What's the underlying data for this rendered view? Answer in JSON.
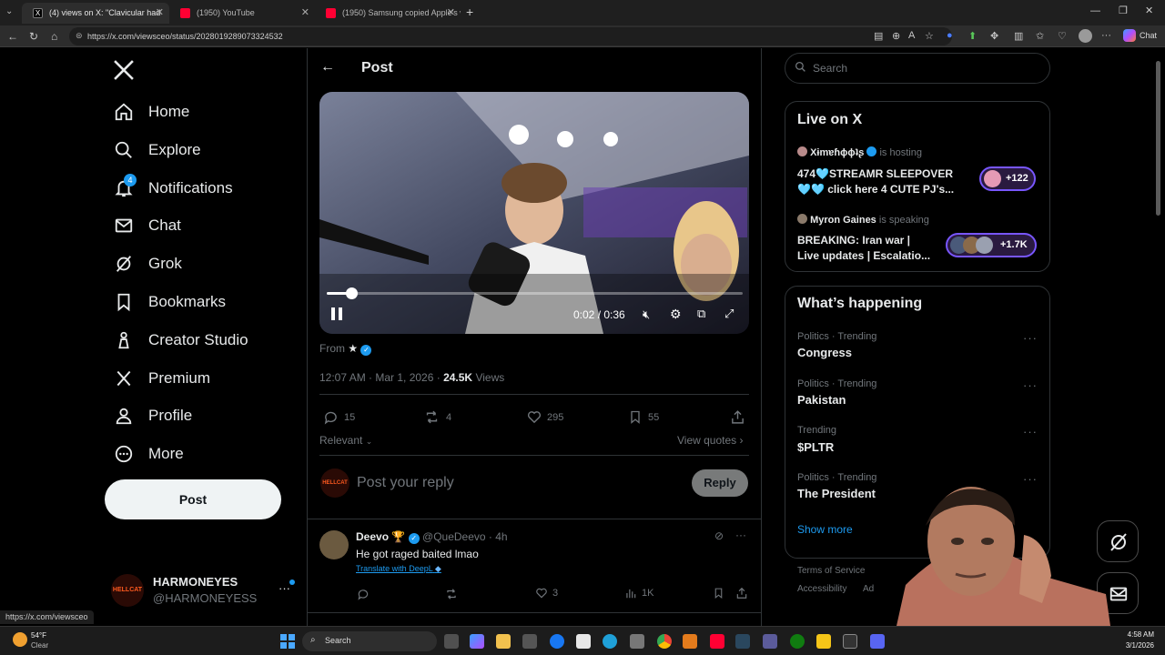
{
  "browser": {
    "tabs": [
      {
        "title": "(4) views on X: \"Clavicular had",
        "active": true
      },
      {
        "title": "(1950) YouTube",
        "active": false
      },
      {
        "title": "(1950) Samsung copied Apple's w",
        "active": false
      }
    ],
    "url": "https://x.com/viewsceo/status/2028019289073324532",
    "copilot_label": "Chat",
    "status_url": "https://x.com/viewsceo"
  },
  "nav": {
    "items": [
      {
        "label": "Home",
        "icon": "home-icon"
      },
      {
        "label": "Explore",
        "icon": "search-icon"
      },
      {
        "label": "Notifications",
        "icon": "bell-icon",
        "badge": "4"
      },
      {
        "label": "Chat",
        "icon": "mail-icon"
      },
      {
        "label": "Grok",
        "icon": "grok-icon"
      },
      {
        "label": "Bookmarks",
        "icon": "bookmark-icon"
      },
      {
        "label": "Creator Studio",
        "icon": "creator-studio-icon"
      },
      {
        "label": "Premium",
        "icon": "x-logo-icon"
      },
      {
        "label": "Profile",
        "icon": "person-icon"
      },
      {
        "label": "More",
        "icon": "more-circle-icon"
      }
    ],
    "post_button": "Post",
    "account": {
      "name": "HARMONEYES",
      "handle": "@HARMONEYESS",
      "avatar_text": "HELLCAT"
    }
  },
  "post": {
    "header_title": "Post",
    "video": {
      "time": "0:02 / 0:36",
      "progress": 0.06
    },
    "from_label": "From",
    "from_name": "★",
    "timestamp": "12:07 AM · Mar 1, 2026 ·",
    "views_count": "24.5K",
    "views_label": "Views",
    "replies": "15",
    "reposts": "4",
    "likes": "295",
    "bookmarks": "55",
    "sort_label": "Relevant",
    "view_quotes": "View quotes",
    "reply_placeholder": "Post your reply",
    "reply_button": "Reply"
  },
  "reply": {
    "name": "Deevo",
    "badge": "🏆",
    "handle": "@QueDeevo",
    "age": "· 4h",
    "text": "He got raged baited lmao",
    "translate": "Translate with DeepL",
    "reposts": "",
    "likes": "3",
    "views": "1K"
  },
  "sidebar": {
    "search_placeholder": "Search",
    "live_title": "Live on X",
    "live": [
      {
        "host": "Xɨmɐɦϕϕʇʂ",
        "status": "is hosting",
        "title1": "474🩵STREAMR SLEEPOVER",
        "title2": "🩵🩵 click here 4 CUTE PJ's...",
        "count": "+122"
      },
      {
        "host": "Myron Gaines",
        "status": "is speaking",
        "title1": "BREAKING: Iran war |",
        "title2": "Live updates | Escalatio...",
        "count": "+1.7K"
      }
    ],
    "happening_title": "What’s happening",
    "trends": [
      {
        "category": "Politics · Trending",
        "name": "Congress"
      },
      {
        "category": "Politics · Trending",
        "name": "Pakistan"
      },
      {
        "category": "Trending",
        "name": "$PLTR"
      },
      {
        "category": "Politics · Trending",
        "name": "The President"
      }
    ],
    "show_more": "Show more",
    "footer1": "Terms of Service",
    "footer2": "Accessibility",
    "footer3": "Ad"
  },
  "taskbar": {
    "weather_temp": "54°F",
    "weather_cond": "Clear",
    "search": "Search",
    "time": "4:58 AM",
    "date": "3/1/2026"
  },
  "colors": {
    "accent": "#1d9bf0",
    "live_purple": "#7856ff",
    "bg": "#000000",
    "border": "#2f3336"
  }
}
